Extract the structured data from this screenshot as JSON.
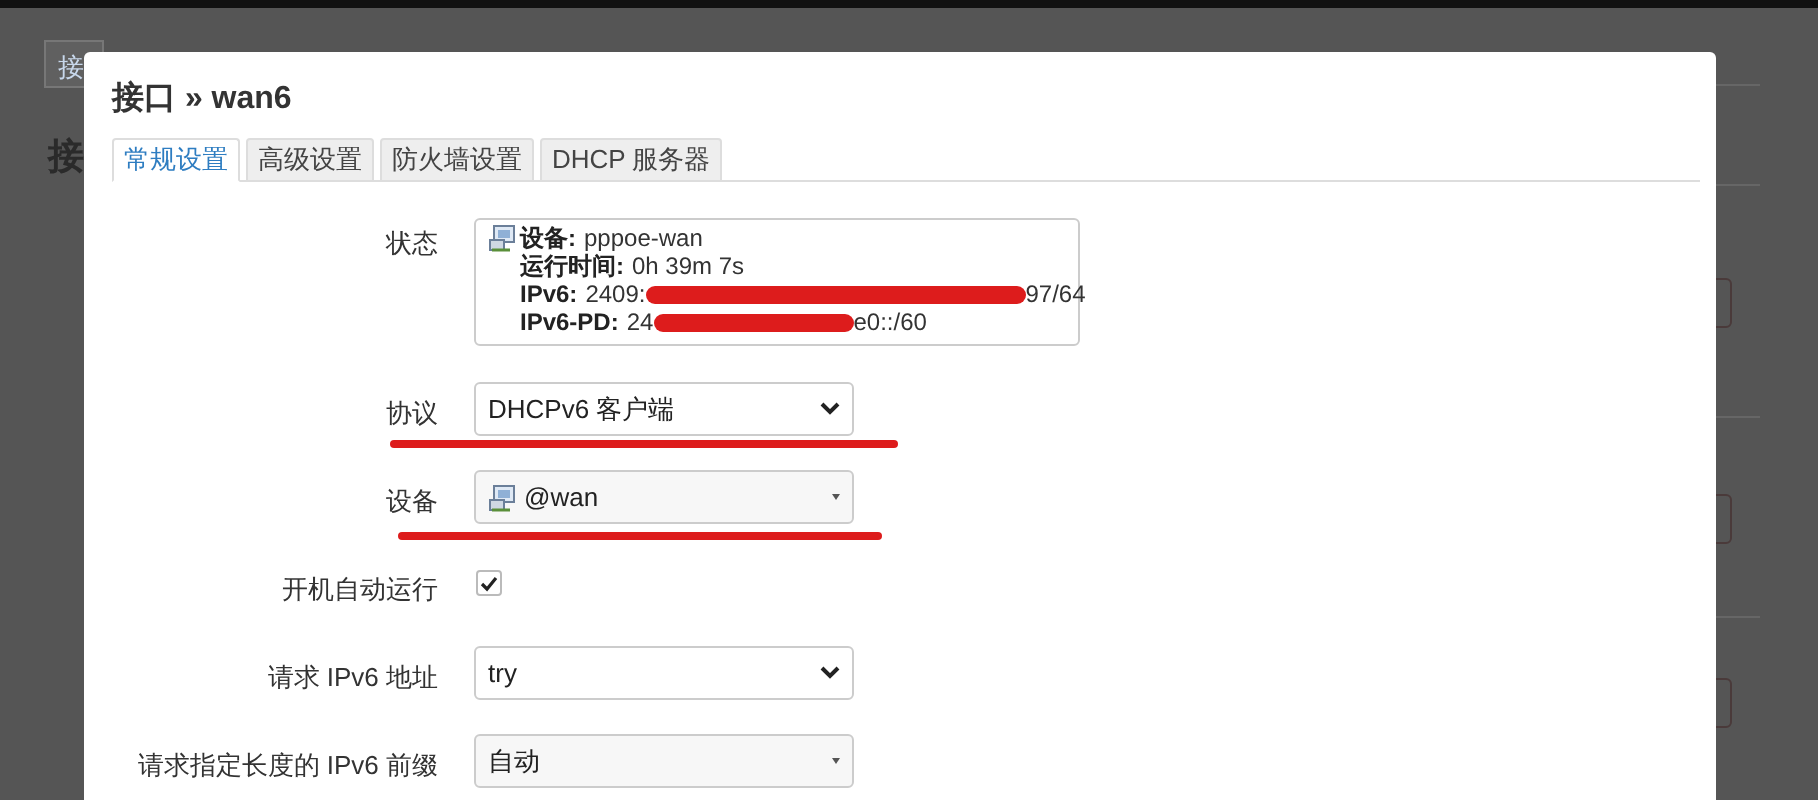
{
  "background_page": {
    "tab_fragment": "接",
    "heading_fragment": "接"
  },
  "dialog": {
    "title": "接口 » wan6",
    "tabs": [
      {
        "label": "常规设置",
        "selected": true
      },
      {
        "label": "高级设置",
        "selected": false
      },
      {
        "label": "防火墙设置",
        "selected": false
      },
      {
        "label": "DHCP 服务器",
        "selected": false
      }
    ],
    "rows": [
      {
        "kind": "status",
        "label": "状态",
        "lines": [
          {
            "key": "设备:",
            "value": "pppoe-wan"
          },
          {
            "key": "运行时间:",
            "value": "0h 39m 7s"
          },
          {
            "key": "IPv6:",
            "value": "2409:",
            "value_end": "97/64",
            "redacted": true
          },
          {
            "key": "IPv6-PD:",
            "value": "24",
            "value_end": "e0::/60",
            "redacted": true
          }
        ],
        "underlined": false
      },
      {
        "kind": "select",
        "label": "协议",
        "value": "DHCPv6 客户端",
        "underlined": true
      },
      {
        "kind": "device",
        "label": "设备",
        "value": "@wan",
        "underlined": true
      },
      {
        "kind": "checkbox",
        "label": "开机自动运行",
        "checked": true,
        "underlined": false
      },
      {
        "kind": "select",
        "label": "请求 IPv6 地址",
        "value": "try",
        "underlined": false
      },
      {
        "kind": "dropdown",
        "label": "请求指定长度的 IPv6 前缀",
        "value": "自动",
        "underlined": false
      }
    ]
  }
}
